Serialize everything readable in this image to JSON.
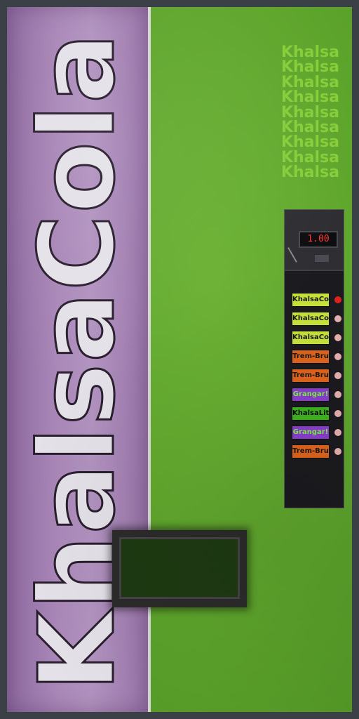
{
  "brand": {
    "name": "KhalsaCola"
  },
  "repeat_text": [
    "Khalsa",
    "Khalsa",
    "Khalsa",
    "Khalsa",
    "Khalsa",
    "Khalsa",
    "Khalsa",
    "Khalsa",
    "Khalsa"
  ],
  "panel": {
    "price_display": "1.00"
  },
  "selections": [
    {
      "label": "KhalsaCola",
      "bg": "#c8e23a",
      "fg": "#1a1a1a",
      "led": "#e02020"
    },
    {
      "label": "KhalsaCola",
      "bg": "#c8e23a",
      "fg": "#1a1a1a",
      "led": "#e8b0b0"
    },
    {
      "label": "KhalsaCola",
      "bg": "#c8e23a",
      "fg": "#1a1a1a",
      "led": "#e8b0b0"
    },
    {
      "label": "Trem-Bru",
      "bg": "#e0641c",
      "fg": "#1a1a1a",
      "led": "#e8b0b0"
    },
    {
      "label": "Trem-Bru",
      "bg": "#e0641c",
      "fg": "#1a1a1a",
      "led": "#e8b0b0"
    },
    {
      "label": "Grangar!",
      "bg": "#8a3fd0",
      "fg": "#7cf040",
      "led": "#e8b0b0"
    },
    {
      "label": "KhalsaLite",
      "bg": "#3fb320",
      "fg": "#0a0a0a",
      "led": "#e8b0b0"
    },
    {
      "label": "Grangar!",
      "bg": "#8a3fd0",
      "fg": "#7cf040",
      "led": "#e8b0b0"
    },
    {
      "label": "Trem-Bru",
      "bg": "#e0641c",
      "fg": "#1a1a1a",
      "led": "#e8b0b0"
    }
  ],
  "colors": {
    "face": "#5ea52c",
    "panel": "#a987b8",
    "frame": "#3b4046"
  }
}
